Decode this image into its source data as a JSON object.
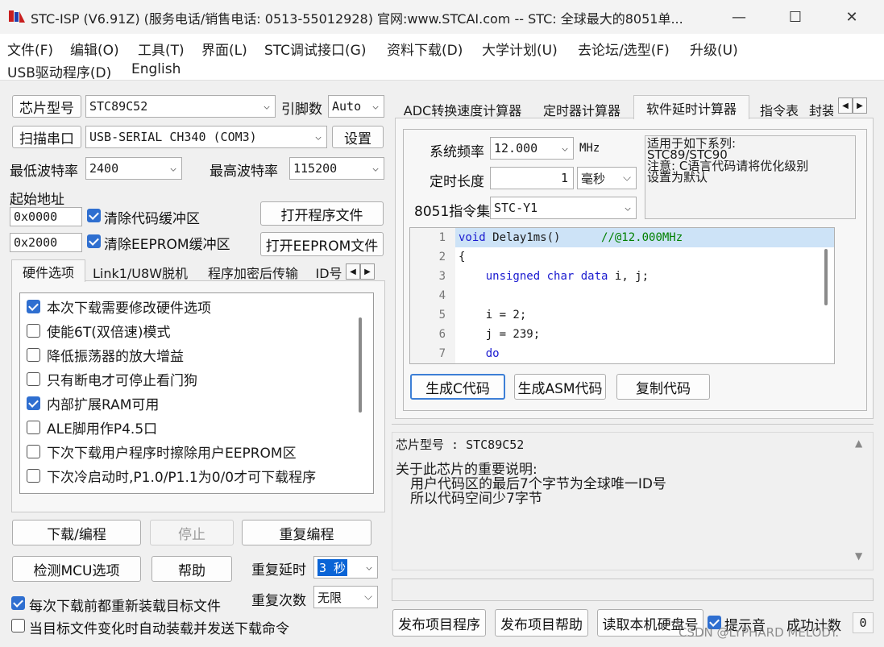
{
  "window": {
    "title": "STC-ISP (V6.91Z) (服务电话/销售电话: 0513-55012928) 官网:www.STCAI.com  -- STC: 全球最大的8051单...",
    "minimize_glyph": "—",
    "maximize_glyph": "☐",
    "close_glyph": "✕"
  },
  "menu": {
    "row1": [
      "文件(F)",
      "编辑(O)",
      "工具(T)",
      "界面(L)",
      "STC调试接口(G)",
      "资料下载(D)",
      "大学计划(U)",
      "去论坛/选型(F)",
      "升级(U)"
    ],
    "row2": [
      "USB驱动程序(D)",
      "English"
    ]
  },
  "left": {
    "chip_type_button": "芯片型号",
    "chip_type_value": "STC89C52",
    "pin_count_label": "引脚数",
    "pin_count_value": "Auto",
    "scan_port_button": "扫描串口",
    "port_value": "USB-SERIAL CH340 (COM3)",
    "settings_button": "设置",
    "min_baud_label": "最低波特率",
    "min_baud_value": "2400",
    "max_baud_label": "最高波特率",
    "max_baud_value": "115200",
    "start_address_label": "起始地址",
    "code_address": "0x0000",
    "clear_code_label": "清除代码缓冲区",
    "open_program_button": "打开程序文件",
    "eeprom_address": "0x2000",
    "clear_eeprom_label": "清除EEPROM缓冲区",
    "open_eeprom_button": "打开EEPROM文件",
    "tabs": [
      "硬件选项",
      "Link1/U8W脱机",
      "程序加密后传输",
      "ID号"
    ],
    "hw_options": [
      {
        "label": "本次下载需要修改硬件选项",
        "checked": true
      },
      {
        "label": "使能6T(双倍速)模式",
        "checked": false
      },
      {
        "label": "降低振荡器的放大增益",
        "checked": false
      },
      {
        "label": "只有断电才可停止看门狗",
        "checked": false
      },
      {
        "label": "内部扩展RAM可用",
        "checked": true
      },
      {
        "label": "ALE脚用作P4.5口",
        "checked": false
      },
      {
        "label": "下次下载用户程序时擦除用户EEPROM区",
        "checked": false
      },
      {
        "label": "下次冷启动时,P1.0/P1.1为0/0才可下载程序",
        "checked": false
      }
    ],
    "download_button": "下载/编程",
    "stop_button": "停止",
    "reprogram_button": "重复编程",
    "detect_mcu_button": "检测MCU选项",
    "help_button": "帮助",
    "repeat_delay_label": "重复延时",
    "repeat_delay_value": "3 秒",
    "reload_before_download_label": "每次下载前都重新装载目标文件",
    "repeat_count_label": "重复次数",
    "repeat_count_value": "无限",
    "auto_reload_label": "当目标文件变化时自动装载并发送下载命令"
  },
  "right": {
    "tabs": [
      "ADC转换速度计算器",
      "定时器计算器",
      "软件延时计算器",
      "指令表",
      "封装"
    ],
    "system_freq_label": "系统频率",
    "system_freq_value": "12.000",
    "freq_unit": "MHz",
    "delay_length_label": "定时长度",
    "delay_length_value": "1",
    "delay_unit": "毫秒",
    "instruction_set_label": "8051指令集",
    "instruction_set_value": "STC-Y1",
    "applicable_series_text": "适用于如下系列:\nSTC89/STC90\n注意: C语言代码请将优化级别\n设置为默认",
    "code_lines": [
      {
        "num": "1",
        "text": "void Delay1ms()\t\t//@12.000MHz"
      },
      {
        "num": "2",
        "text": "{"
      },
      {
        "num": "3",
        "text": "\tunsigned char data i, j;"
      },
      {
        "num": "4",
        "text": ""
      },
      {
        "num": "5",
        "text": "\ti = 2;"
      },
      {
        "num": "6",
        "text": "\tj = 239;"
      },
      {
        "num": "7",
        "text": "\tdo"
      }
    ],
    "gen_c_button": "生成C代码",
    "gen_asm_button": "生成ASM代码",
    "copy_code_button": "复制代码",
    "info_chip_line": "芯片型号 : STC89C52",
    "info_note_title": "关于此芯片的重要说明:",
    "info_note_1": "用户代码区的最后7个字节为全球唯一ID号",
    "info_note_2": "所以代码空间少7字节",
    "publish_program_button": "发布项目程序",
    "publish_help_button": "发布项目帮助",
    "read_hdd_button": "读取本机硬盘号",
    "beep_label": "提示音",
    "success_count_label": "成功计数",
    "success_count_value": "0"
  },
  "watermark": "CSDN @LYPHARD MELODY."
}
